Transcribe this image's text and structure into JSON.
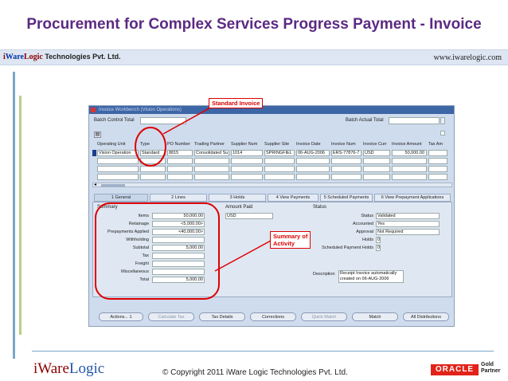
{
  "slide": {
    "title": "Procurement for Complex Services Progress Payment - Invoice",
    "brand_i": "i",
    "brand_ware": "Ware",
    "brand_logic": "Logic",
    "brand_rest": " Technologies Pvt. Ltd.",
    "url": "www.iwarelogic.com",
    "footer_logo_a": "iWare",
    "footer_logo_b": "Logic",
    "copyright": "© Copyright 2011 iWare Logic Technologies Pvt. Ltd.",
    "oracle_logo": "ORACLE",
    "partner_line1": "Gold",
    "partner_line2": "Partner"
  },
  "colors": {
    "title": "#5b2a82",
    "annotation": "#dd0000",
    "window_title_bar": "#3d66a6"
  },
  "window": {
    "title": "Invoice Workbench (Vision Operations)",
    "batch_control_total": "Batch Control Total",
    "batch_actual_total": "Batch Actual Total",
    "columns": [
      "Operating Unit",
      "Type",
      "PO Number",
      "Trading Partner",
      "Supplier Num",
      "Supplier Site",
      "Invoice Date",
      "Invoice Num",
      "Invoice Curr",
      "Invoice Amount",
      "Tax Am"
    ],
    "row": [
      "Vision Operation",
      "Standard",
      "8815",
      "Consolidated Su",
      "1014",
      "SPRINGFIEL",
      "06-AUG-2006",
      "ERS-77876-7",
      "USD",
      "50,000.00",
      ""
    ],
    "tabs": [
      "1 General",
      "2 Lines",
      "3 Holds",
      "4 View Payments",
      "5 Scheduled Payments",
      "6 View Prepayment Applications"
    ],
    "summary": {
      "heading": "Summary",
      "items": [
        {
          "label": "Items",
          "value": "50,000.00"
        },
        {
          "label": "Retainage",
          "value": "<5,000.00>"
        },
        {
          "label": "Prepayments Applied",
          "value": "<40,000.00>"
        },
        {
          "label": "Withholding",
          "value": ""
        },
        {
          "label": "Subtotal",
          "value": "5,000.00"
        },
        {
          "label": "Tax",
          "value": ""
        },
        {
          "label": "Freight",
          "value": ""
        },
        {
          "label": "Miscellaneous",
          "value": ""
        },
        {
          "label": "Total",
          "value": "5,000.00"
        }
      ]
    },
    "amount_paid": {
      "heading": "Amount Paid",
      "currency": "USD"
    },
    "status": {
      "heading": "Status",
      "items": [
        {
          "label": "Status",
          "value": "Validated"
        },
        {
          "label": "Accounted",
          "value": "Yes"
        },
        {
          "label": "Approval",
          "value": "Not Required"
        },
        {
          "label": "Holds",
          "value": "0"
        },
        {
          "label": "Scheduled Payment Holds",
          "value": "0"
        }
      ],
      "description_label": "Description",
      "description_value": "Receipt Invoice automatically created on 06-AUG-2006"
    },
    "buttons": [
      "Actions... 1",
      "Calculate Tax",
      "Tax Details",
      "Corrections",
      "Quick Match",
      "Match",
      "All Distributions"
    ]
  },
  "annotations": {
    "standard_invoice": "Standard Invoice",
    "summary_of_activity_1": "Summary of",
    "summary_of_activity_2": "Activity"
  }
}
